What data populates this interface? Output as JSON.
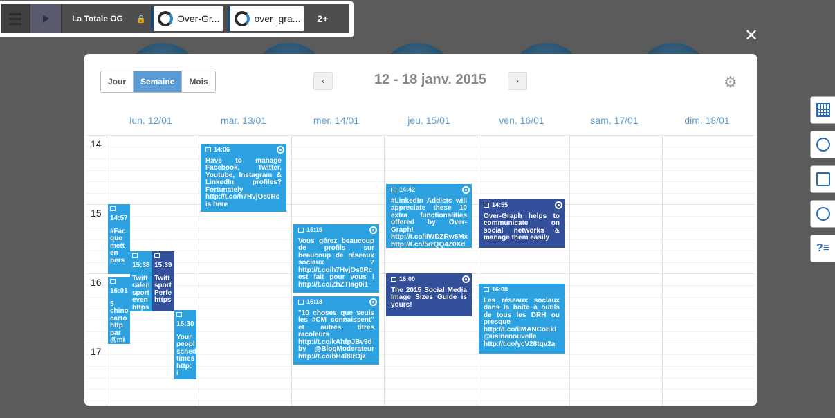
{
  "topbar": {
    "title": "La Totale OG",
    "tabs": [
      {
        "label": "Over-Gr..."
      },
      {
        "label": "over_gra..."
      }
    ],
    "more_label": "2+"
  },
  "close_label": "✕",
  "calendar": {
    "views": {
      "day": "Jour",
      "week": "Semaine",
      "month": "Mois",
      "active": "Semaine"
    },
    "range_label": "12 - 18 janv. 2015",
    "prev_label": "‹",
    "next_label": "›",
    "days": [
      "lun. 12/01",
      "mar. 13/01",
      "mer. 14/01",
      "jeu. 15/01",
      "ven. 16/01",
      "sam. 17/01",
      "dim. 18/01"
    ],
    "hours": [
      "14",
      "15",
      "16",
      "17"
    ],
    "events": [
      {
        "time": "14:57",
        "text": "#Fac que mett en pers",
        "color": "#2ea2e0"
      },
      {
        "time": "15:38",
        "text": "Twitt calen sport even https #CM",
        "color": "#2ea2e0"
      },
      {
        "time": "15:39",
        "text": "Twitt sport Perfe https",
        "color": "#34509a"
      },
      {
        "time": "16:01",
        "text": "5 chino carto http par @mi",
        "color": "#2ea2e0"
      },
      {
        "time": "16:30",
        "text": "Your peopl sched times http: i",
        "color": "#2ea2e0"
      },
      {
        "time": "14:06",
        "text": "Have to manage Facebook, Twitter, Youtube, Instagram & LinkedIn profiles? Fortunately http://t.co/h7HvjOs0Rc is here",
        "color": "#2ea2e0"
      },
      {
        "time": "15:15",
        "text": "Vous gérez beaucoup de profils sur beaucoup de réseaux sociaux ? http://t.co/h7HvjOs0Rc est fait pour vous ! http://t.co/ZhZTIag0i1",
        "color": "#2ea2e0"
      },
      {
        "time": "16:18",
        "text": "\"10 choses que seuls les #CM connaissent\" et autres titres racoleurs http://t.co/kAhfpJBv9d by @BlogModerateur http://t.co/bH4i8IrOjz",
        "color": "#2ea2e0"
      },
      {
        "time": "14:42",
        "text": "#LinkedIn Addicts will appreciate these 10 extra functionalities offered by Over-Graph! http://t.co/iIWDZRw5Mx http://t.co/5rrQQ4Z0Xd",
        "color": "#2ea2e0"
      },
      {
        "time": "16:00",
        "text": "The 2015 Social Media Image Sizes Guide is yours!",
        "color": "#34509a"
      },
      {
        "time": "14:55",
        "text": "Over-Graph helps to communicate on social networks & manage them easily",
        "color": "#34509a"
      },
      {
        "time": "16:08",
        "text": "Les réseaux sociaux dans la boîte à outils de tous les DRH ou presque http://t.co/iIMANCoEkl @usinenouvelle http://t.co/ycV28tqv2a",
        "color": "#2ea2e0"
      }
    ]
  },
  "right_toolbar": [
    "calendar-icon",
    "clock-icon",
    "document-icon",
    "compass-icon",
    "help-list-icon"
  ]
}
